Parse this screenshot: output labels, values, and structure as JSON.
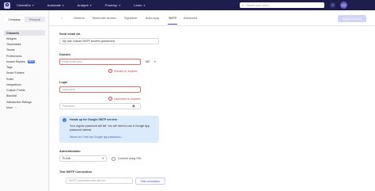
{
  "topbar": {
    "logo": "✿",
    "nav": [
      {
        "label": "CentralDo"
      },
      {
        "label": "Automate"
      },
      {
        "label": "Analyze"
      },
      {
        "label": "Powerup"
      },
      {
        "label": "Learn"
      }
    ],
    "search_placeholder": "Search your inbox...",
    "help": "?",
    "avatar": "CD"
  },
  "sidebar": {
    "segment": {
      "company": "Company",
      "personal": "Personal"
    },
    "items": [
      {
        "label": "Channels"
      },
      {
        "label": "Widgets"
      },
      {
        "label": "Teammates"
      },
      {
        "label": "Teams"
      },
      {
        "label": "Preferences"
      },
      {
        "label": "Instant Replies",
        "badge": "NEW"
      },
      {
        "label": "Tags"
      },
      {
        "label": "Smart Folders"
      },
      {
        "label": "Rules"
      },
      {
        "label": "Integrations"
      },
      {
        "label": "Custom Profile"
      },
      {
        "label": "Blacklist"
      },
      {
        "label": "Satisfaction Ratings"
      },
      {
        "label": "More"
      }
    ]
  },
  "tabs": {
    "back": "←",
    "items": [
      {
        "label": "General"
      },
      {
        "label": "Teammate access"
      },
      {
        "label": "Signature"
      },
      {
        "label": "Auto-reply"
      },
      {
        "label": "SMTP"
      },
      {
        "label": "Advanced"
      }
    ],
    "update_button": "Update account"
  },
  "form": {
    "send_via_label": "Send email via",
    "send_via_value": "My own custom SMTP servers (advanced)",
    "domain_label": "Domain",
    "domain_placeholder": "smtp.email.com",
    "port_value": "587",
    "domain_error": "Domain is required",
    "login_label": "Login",
    "username_placeholder": "Username",
    "username_error": "Username is required",
    "password_placeholder": "Password",
    "info_title": "Heads up for Google SMTP servers",
    "info_body": "Your regular password will fail. You will need to use a Google App password instead.",
    "info_link": "Where do I find my Google app password...",
    "auth_label": "Authentication",
    "auth_value": "PLAIN",
    "ssl_label": "Connect using SSL",
    "test_label": "Test SMTP Connection",
    "test_placeholder": "SMTP connection test will run...",
    "test_button": "Test connection"
  }
}
